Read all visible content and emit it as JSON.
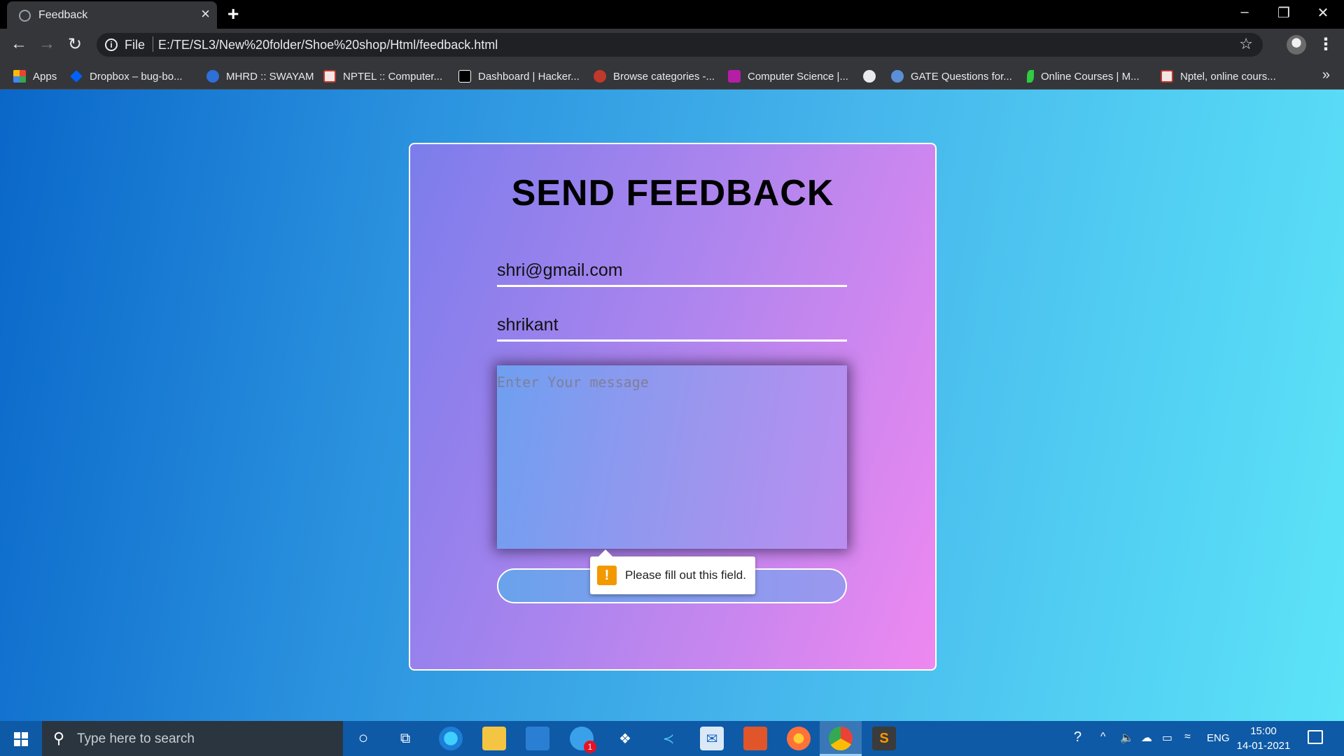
{
  "browser": {
    "tab_title": "Feedback",
    "url_scheme_label": "File",
    "url": "E:/TE/SL3/New%20folder/Shoe%20shop/Html/feedback.html",
    "bookmarks": [
      {
        "label": "Apps",
        "icon": "apps-grid-icon"
      },
      {
        "label": "Dropbox – bug-bo...",
        "icon": "dropbox-icon"
      },
      {
        "label": "MHRD :: SWAYAM",
        "icon": "swayam-icon"
      },
      {
        "label": "NPTEL :: Computer...",
        "icon": "nptel-icon"
      },
      {
        "label": "Dashboard | Hacker...",
        "icon": "hackerrank-icon"
      },
      {
        "label": "Browse categories -...",
        "icon": "browse-icon"
      },
      {
        "label": "Computer Science |...",
        "icon": "cs-icon"
      },
      {
        "label": "",
        "icon": "globe-icon"
      },
      {
        "label": "GATE Questions for...",
        "icon": "gate-icon"
      },
      {
        "label": "Online Courses | M...",
        "icon": "leaf-icon"
      },
      {
        "label": "Nptel, online cours...",
        "icon": "nptel-icon"
      }
    ]
  },
  "form": {
    "title": "SEND FEEDBACK",
    "email_value": "shri@gmail.com",
    "name_value": "shrikant",
    "message_placeholder": "Enter Your message",
    "validation_message": "Please fill out this field."
  },
  "taskbar": {
    "search_placeholder": "Type here to search",
    "language": "ENG",
    "time": "15:00",
    "date": "14-01-2021",
    "mail_badge": "1"
  },
  "colors": {
    "page_gradient_start": "#0a67c9",
    "page_gradient_end": "#5ce4f8",
    "card_gradient_start": "#7b7deb",
    "card_gradient_end": "#ee88f0",
    "warning": "#f29900"
  }
}
